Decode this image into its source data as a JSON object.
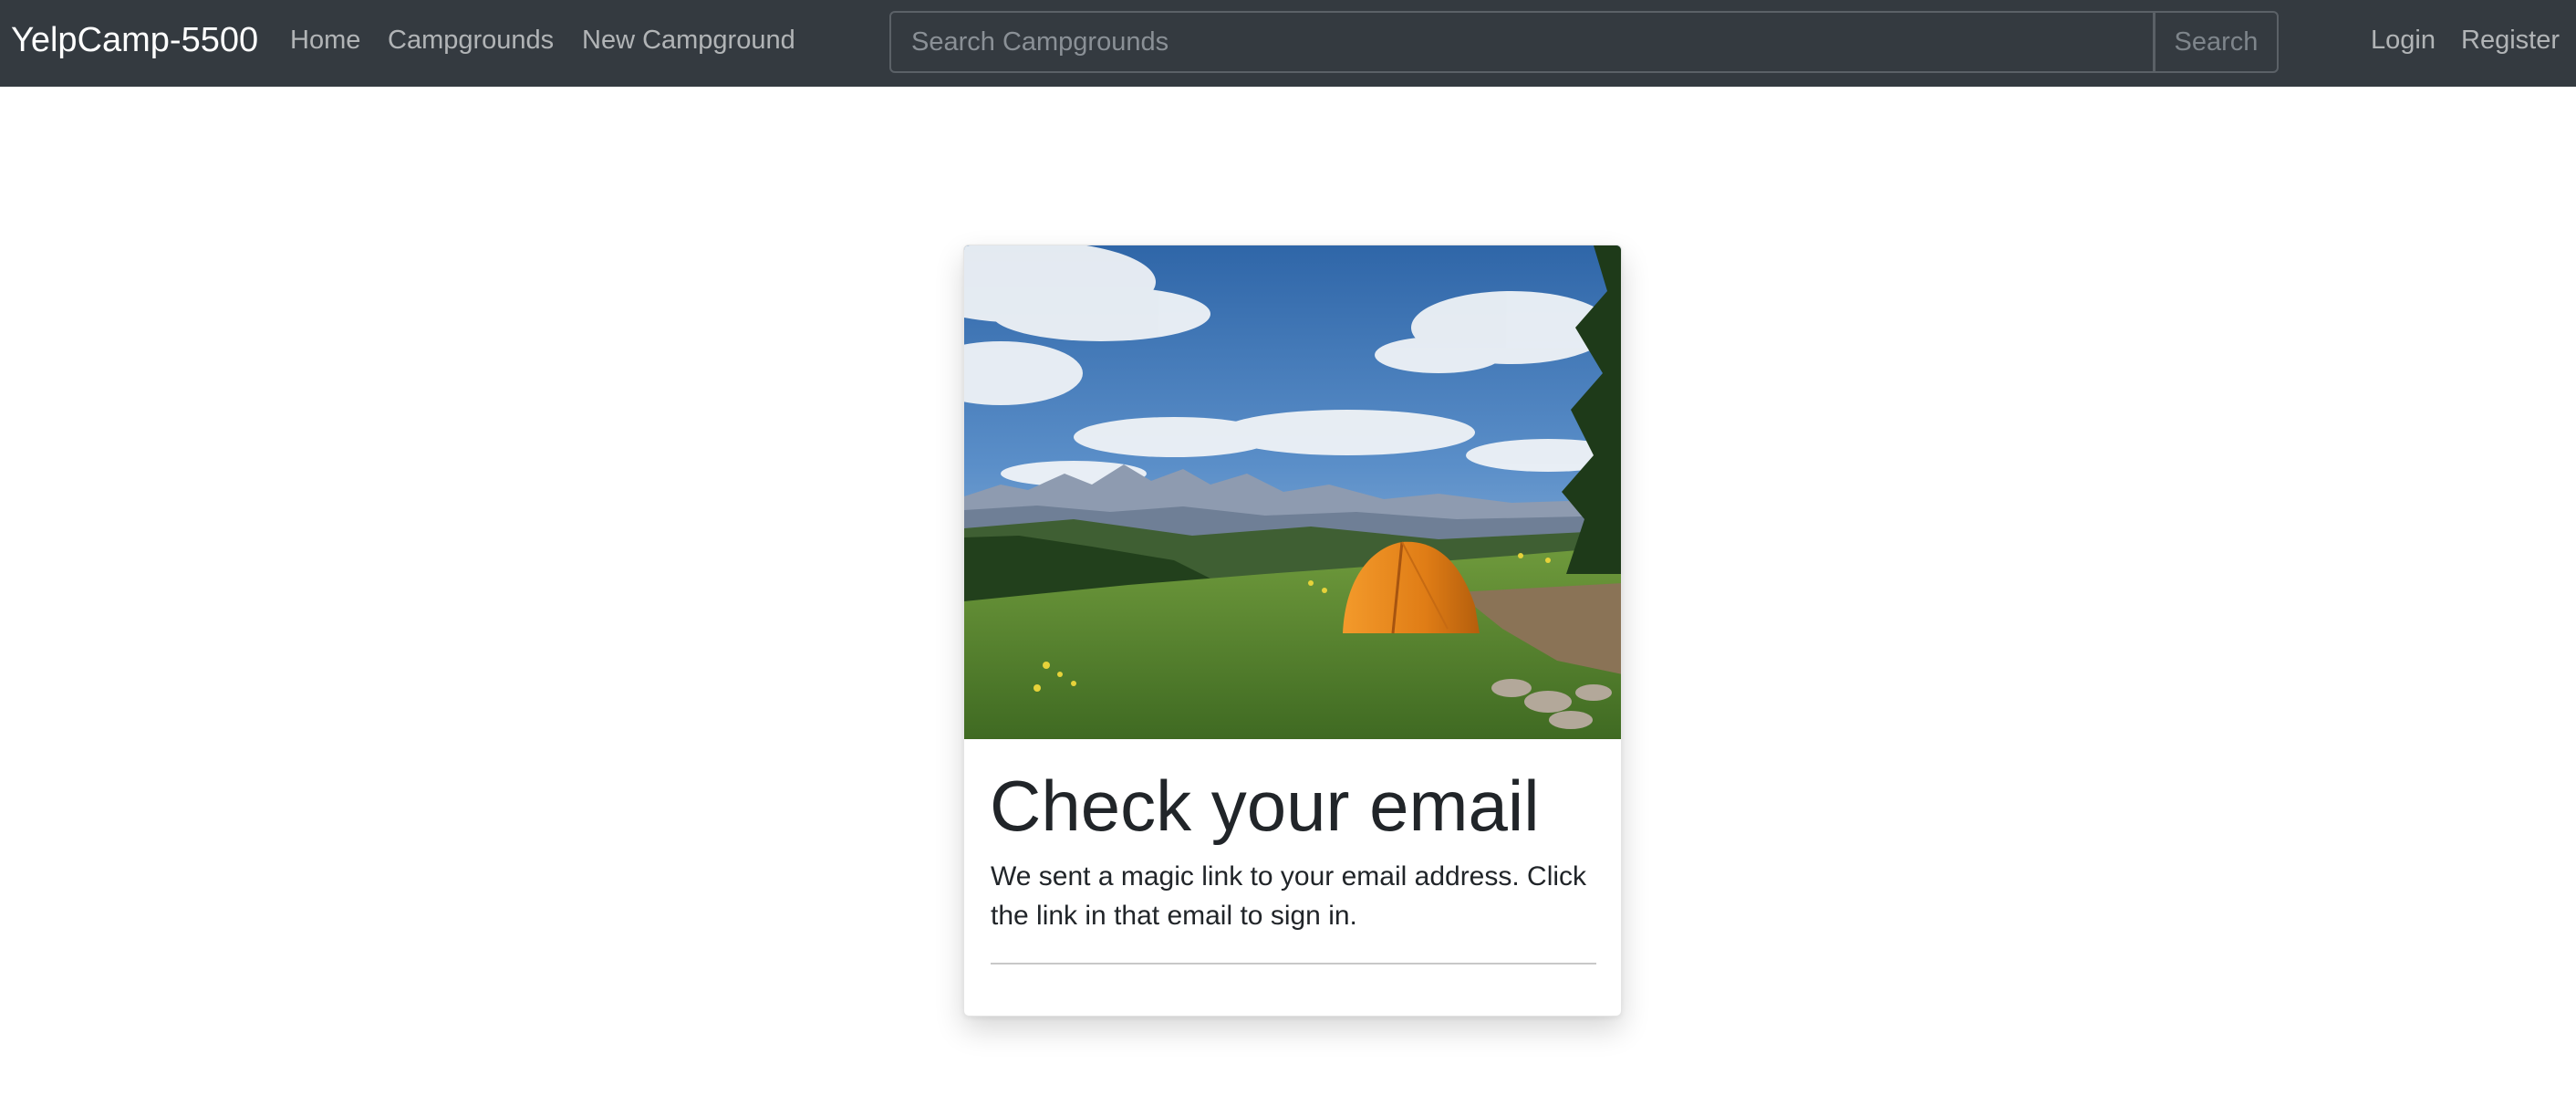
{
  "navbar": {
    "brand": "YelpCamp-5500",
    "links": {
      "home": "Home",
      "campgrounds": "Campgrounds",
      "new_campground": "New Campground",
      "login": "Login",
      "register": "Register"
    },
    "search": {
      "placeholder": "Search Campgrounds",
      "value": "",
      "button_label": "Search"
    }
  },
  "card": {
    "image_alt": "tent-in-mountain-meadow-photo",
    "title": "Check your email",
    "body": "We sent a magic link to your email address. Click the link in that email to sign in."
  },
  "colors": {
    "navbar_bg": "#343a40",
    "brand_text": "#ffffff",
    "nav_link_text": "#9a9da0",
    "tent_orange": "#e8821f",
    "sky_blue": "#4f86c6"
  }
}
